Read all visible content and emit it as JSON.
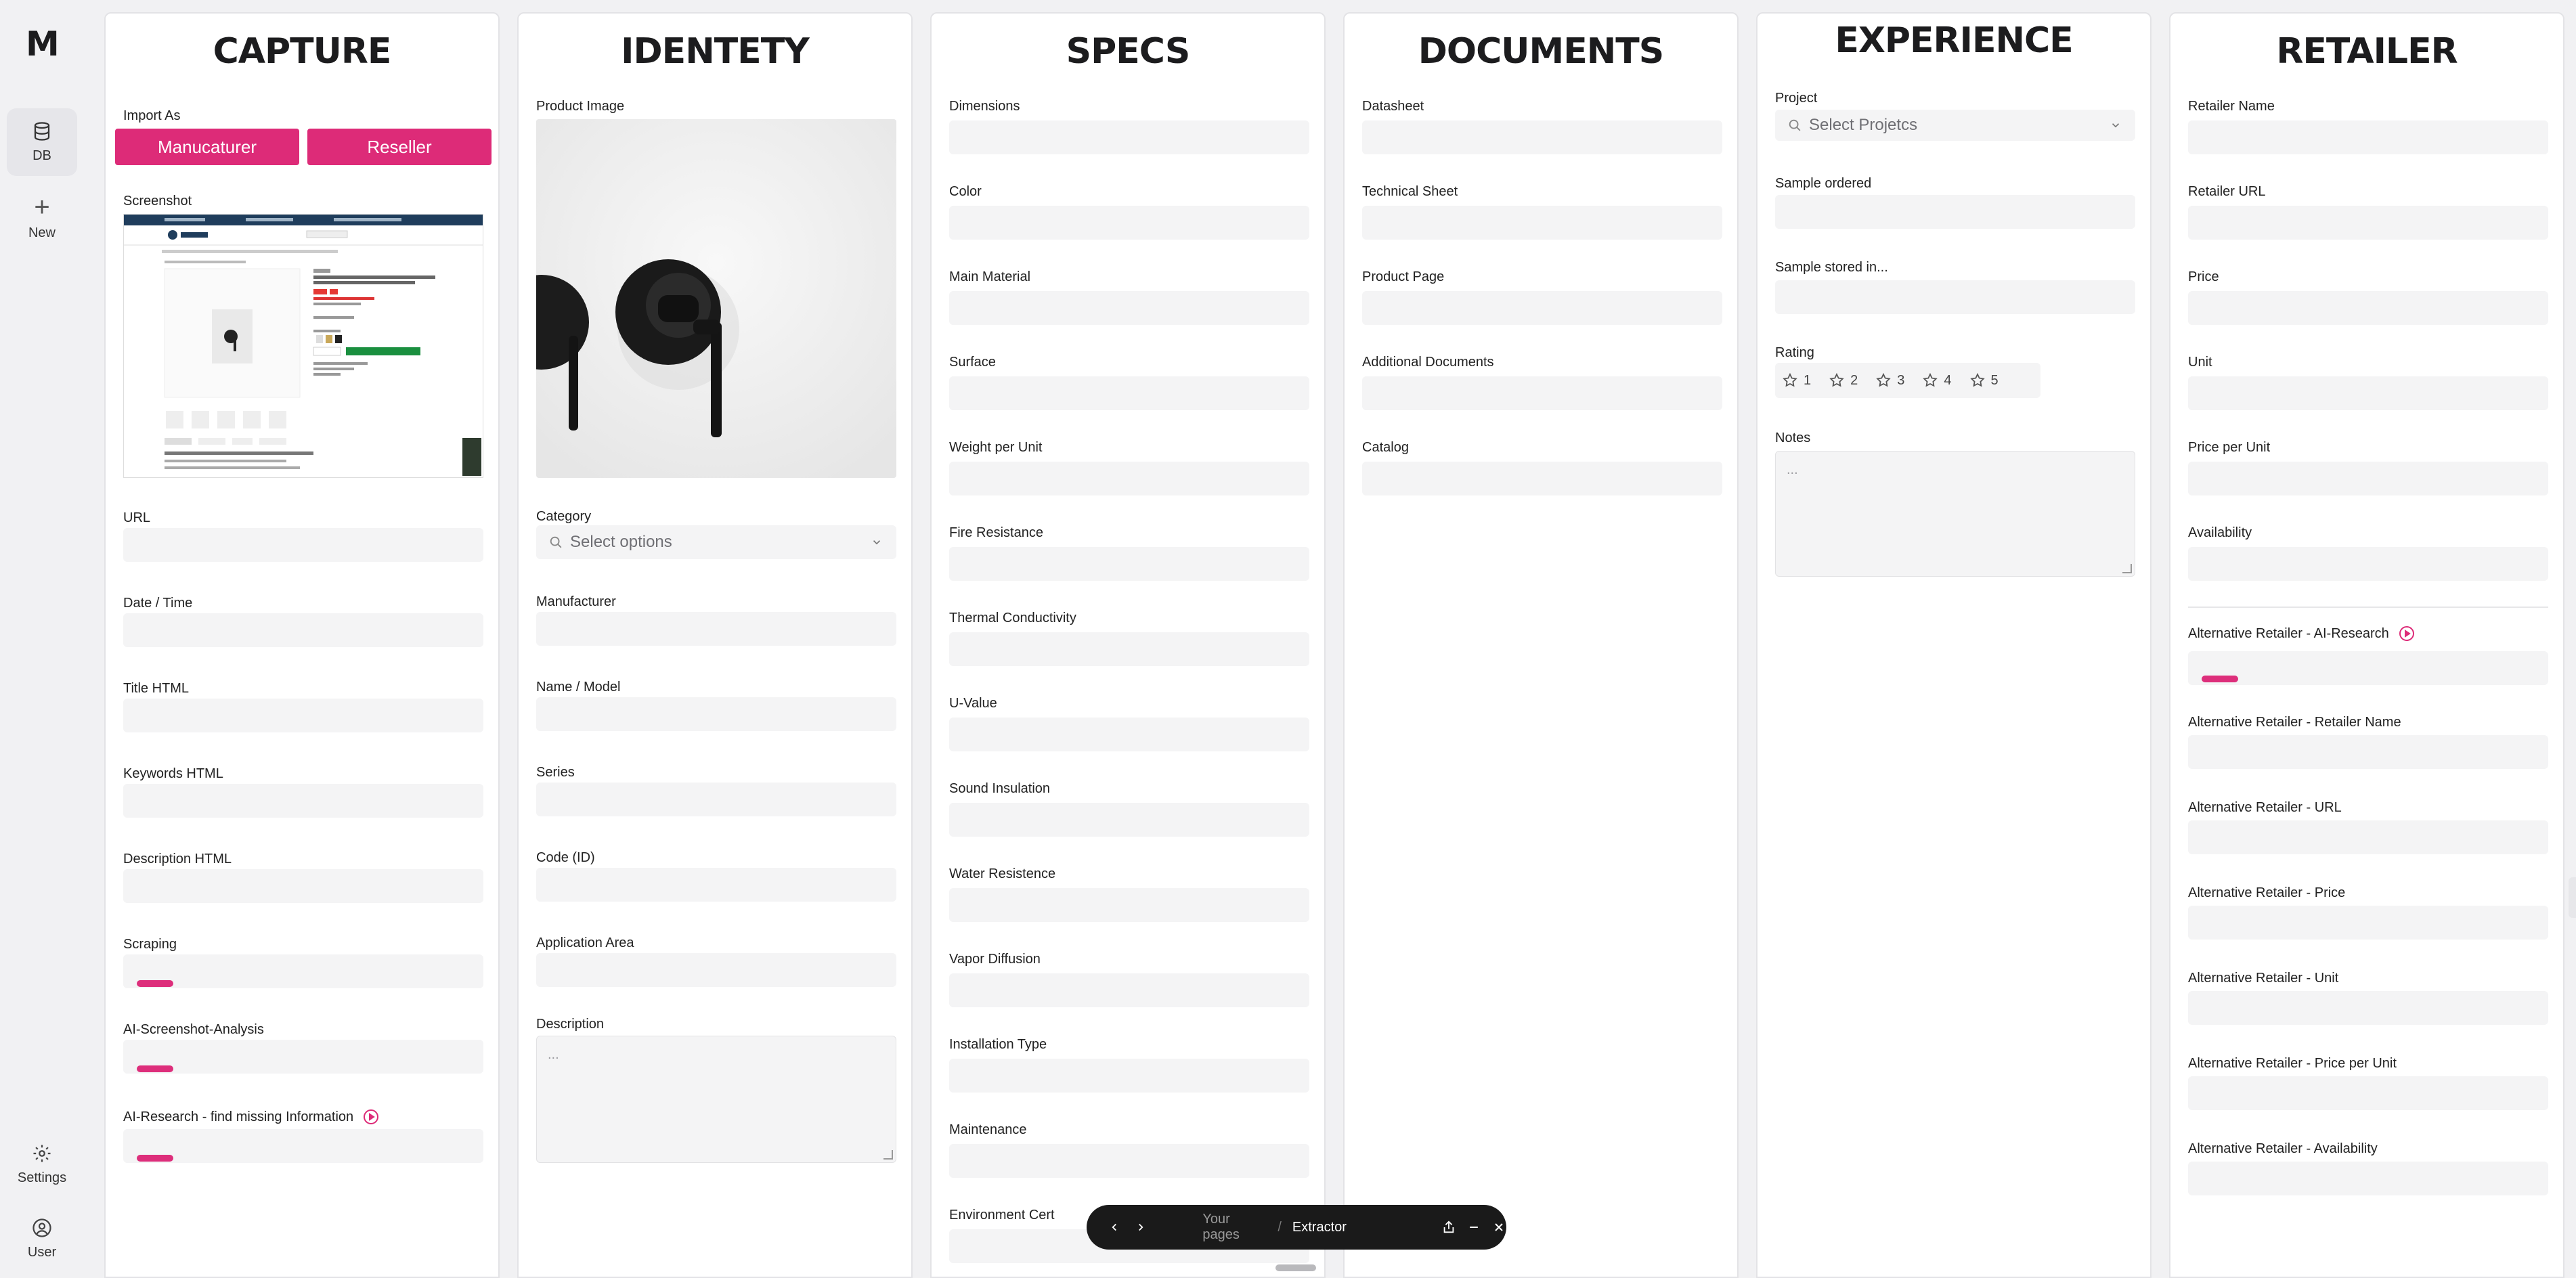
{
  "sidebar": {
    "logo": "M",
    "items": [
      {
        "label": "DB",
        "icon": "database-icon"
      },
      {
        "label": "New",
        "icon": "plus-icon"
      }
    ],
    "bottom": [
      {
        "label": "Settings",
        "icon": "gear-icon"
      },
      {
        "label": "User",
        "icon": "user-circle-icon"
      }
    ]
  },
  "capture": {
    "title": "CAPTURE",
    "import_as": "Import As",
    "btn_manufacturer": "Manucaturer",
    "btn_reseller": "Reseller",
    "screenshot": "Screenshot",
    "fields": [
      "URL",
      "Date / Time",
      "Title HTML",
      "Keywords HTML",
      "Description  HTML"
    ],
    "progress": [
      {
        "label": "Scraping"
      },
      {
        "label": "AI-Screenshot-Analysis"
      },
      {
        "label": "AI-Research - find missing Information"
      }
    ]
  },
  "identity": {
    "title": "IDENTETY",
    "product_image": "Product Image",
    "category": "Category",
    "category_placeholder": "Select options",
    "fields": [
      "Manufacturer",
      "Name / Model",
      "Series",
      "Code (ID)",
      "Application Area"
    ],
    "description": "Description",
    "description_placeholder": "..."
  },
  "specs": {
    "title": "SPECS",
    "fields": [
      "Dimensions",
      "Color",
      "Main Material",
      "Surface",
      "Weight per Unit",
      "Fire Resistance",
      "Thermal Conductivity",
      "U-Value",
      "Sound Insulation",
      "Water Resistence",
      " Vapor Diffusion",
      "Installation Type",
      "Maintenance",
      "Environment Cert"
    ]
  },
  "documents": {
    "title": "DOCUMENTS",
    "fields": [
      "Datasheet",
      "Technical Sheet",
      "Product Page",
      "Additional Documents",
      "Catalog"
    ]
  },
  "experience": {
    "title": "EXPERIENCE",
    "project": "Project",
    "project_placeholder": "Select Projetcs",
    "fields": [
      "Sample ordered",
      "Sample stored in..."
    ],
    "rating": "Rating",
    "rating_values": [
      "1",
      "2",
      "3",
      "4",
      "5"
    ],
    "notes": "Notes",
    "notes_placeholder": "..."
  },
  "retailer": {
    "title": "RETAILER",
    "fields": [
      "Retailer Name",
      "Retailer URL",
      "Price",
      "Unit",
      "Price per Unit",
      "Availability"
    ],
    "ai_research": "Alternative Retailer - AI-Research",
    "alt_fields": [
      "Alternative Retailer - Retailer Name",
      "Alternative Retailer -  URL",
      "Alternative Retailer - Price",
      "Alternative Retailer - Unit",
      "Alternative Retailer - Price per Unit",
      "Alternative Retailer - Availability"
    ]
  },
  "toolbar": {
    "crumb_parent": "Your pages",
    "separator": "/",
    "crumb_current": "Extractor"
  },
  "colors": {
    "accent": "#dd2b78",
    "field_bg": "#f4f4f5",
    "toolbar_bg": "#1a1a1a"
  }
}
